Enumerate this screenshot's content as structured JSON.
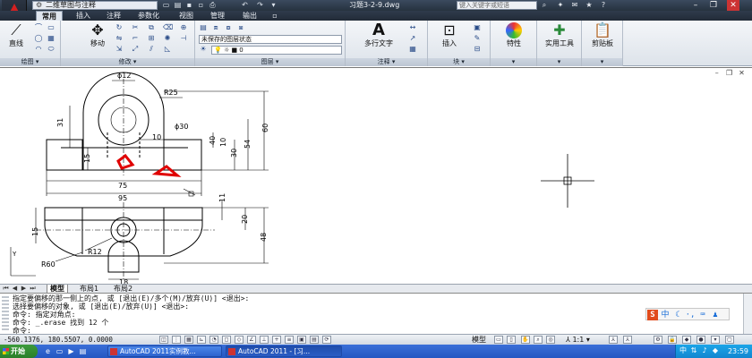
{
  "titlebar": {
    "workspace": "二维草图与注释",
    "document_title": "习题3-2-9.dwg",
    "search_placeholder": "键入关键字或短语"
  },
  "ribbon_tabs": [
    "常用",
    "插入",
    "注释",
    "参数化",
    "视图",
    "管理",
    "输出"
  ],
  "active_tab": "常用",
  "ribbon": {
    "draw_line_label": "直线",
    "modify_move_label": "移动",
    "layer_state": "未保存的图层状态",
    "layer_current": "0",
    "multiline_text_label": "多行文字",
    "insert_label": "插入",
    "properties_label": "特性",
    "utilities_label": "实用工具",
    "clipboard_label": "剪贴板",
    "panels": {
      "draw": "绘图",
      "modify": "修改",
      "layers": "图层",
      "annotation": "注释",
      "block": "块"
    }
  },
  "drawing": {
    "dims": [
      "ϕ12",
      "R25",
      "31",
      "ϕ30",
      "10",
      "40",
      "10",
      "30",
      "54",
      "60",
      "15",
      "75",
      "95",
      "11",
      "20",
      "48",
      "15",
      "R12",
      "R60",
      "18"
    ],
    "accent": "#e00000"
  },
  "layout_tabs": [
    "模型",
    "布局1",
    "布局2"
  ],
  "active_layout": "模型",
  "command_lines": [
    "指定要偏移的那一侧上的点, 或 [退出(E)/多个(M)/放弃(U)] <退出>:",
    "选择要偏移的对象, 或 [退出(E)/放弃(U)] <退出>:",
    "命令: 指定对角点:",
    "命令: _.erase 找到 12 个",
    "命令:"
  ],
  "statusbar": {
    "coords": "-560.1376, 180.5507, 0.0000",
    "model": "模型",
    "scale": "1:1"
  },
  "taskbar": {
    "start": "开始",
    "tasks": [
      "AutoCAD 2011实例教...",
      "AutoCAD 2011 - [习..."
    ],
    "clock": "23:59"
  }
}
